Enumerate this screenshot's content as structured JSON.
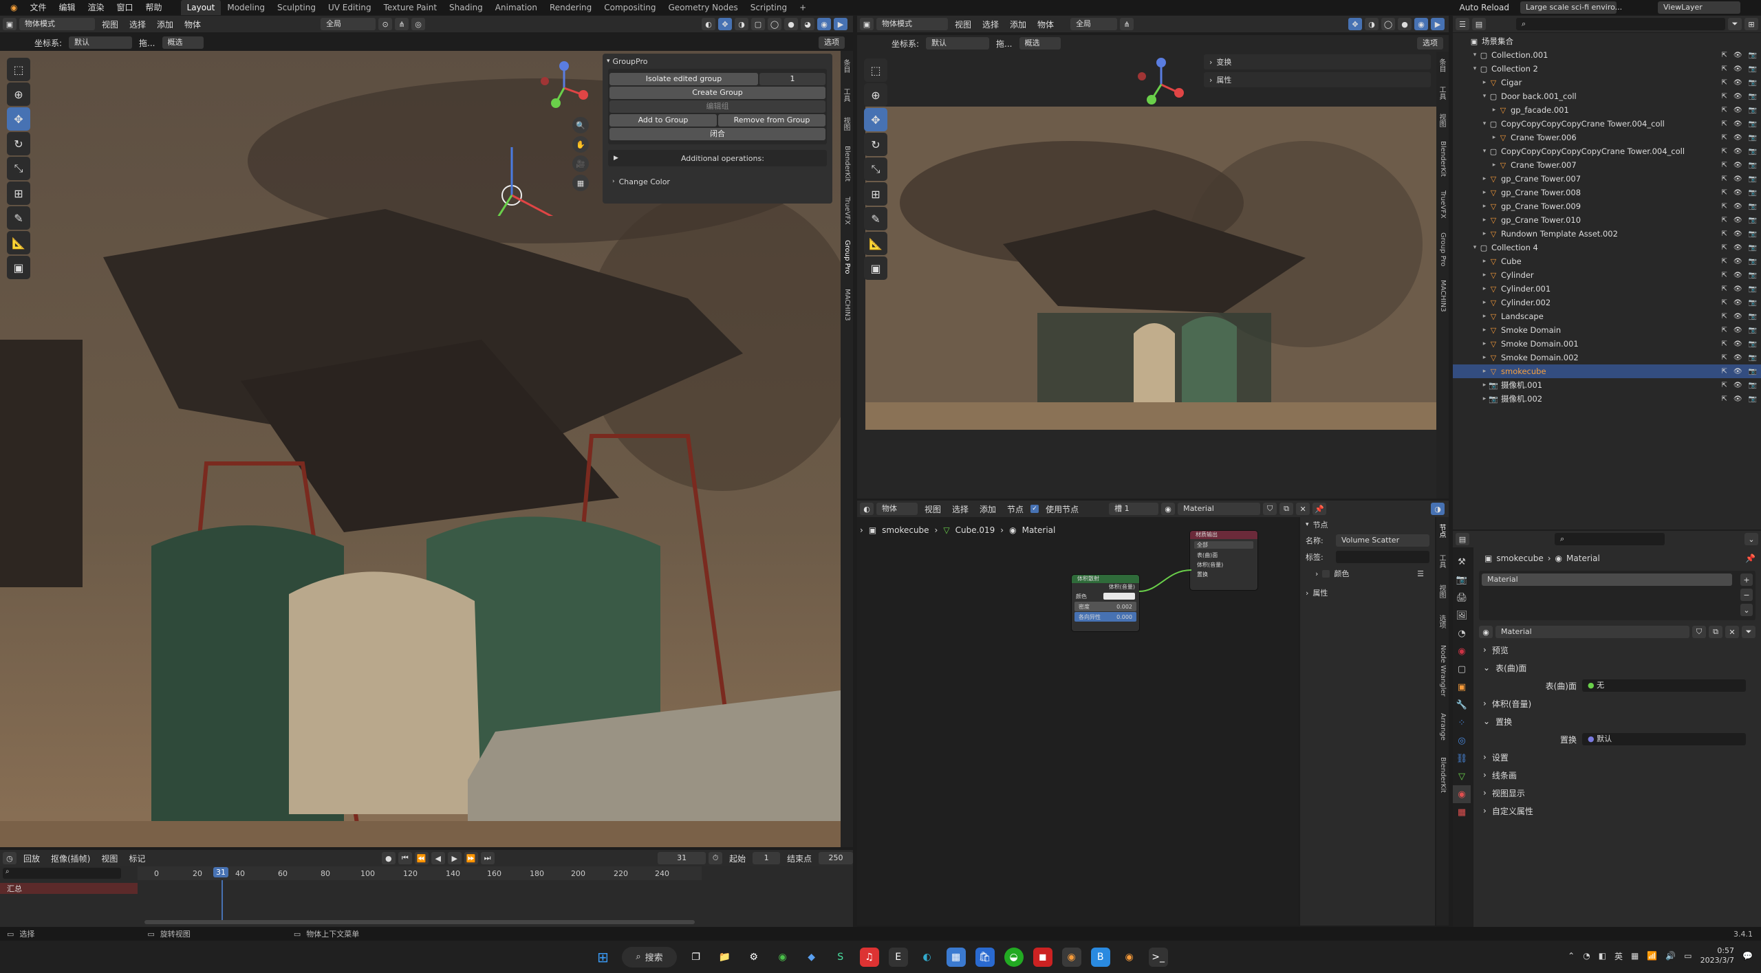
{
  "topbar": {
    "menus": [
      "文件",
      "编辑",
      "渲染",
      "窗口",
      "帮助"
    ],
    "workspaces": [
      "Layout",
      "Modeling",
      "Sculpting",
      "UV Editing",
      "Texture Paint",
      "Shading",
      "Animation",
      "Rendering",
      "Compositing",
      "Geometry Nodes",
      "Scripting"
    ],
    "add_tab": "+",
    "auto_reload": "Auto Reload",
    "scene_name": "Large scale sci-fi enviro...",
    "view_layer": "ViewLayer"
  },
  "viewport_left": {
    "mode": "物体模式",
    "menus": [
      "视图",
      "选择",
      "添加",
      "物体"
    ],
    "transform_space": "全局",
    "coord_label": "坐标系:",
    "coord_value": "默认",
    "drag_label": "拖...",
    "drag_value": "概选",
    "options_label": "选项",
    "side_tabs": [
      "条目",
      "工具",
      "视图",
      "BlenderKit",
      "TrueVFX",
      "Group Pro",
      "MACHIN3"
    ]
  },
  "grouppro": {
    "title": "GroupPro",
    "isolate_label": "Isolate edited group",
    "isolate_value": "1",
    "create_group": "Create Group",
    "edit_group": "编辑组",
    "add_to_group": "Add to Group",
    "remove_from_group": "Remove from Group",
    "close_label": "闭合",
    "additional_ops": "Additional operations:",
    "change_color": "Change Color"
  },
  "viewport_right": {
    "mode": "物体模式",
    "menus": [
      "视图",
      "选择",
      "添加",
      "物体"
    ],
    "transform_space": "全局",
    "coord_label": "坐标系:",
    "coord_value": "默认",
    "drag_label": "拖...",
    "drag_value": "概选",
    "options_label": "选项",
    "n_panel": [
      "变换",
      "属性"
    ],
    "side_tabs": [
      "条目",
      "工具",
      "视图",
      "BlenderKit",
      "TrueVFX",
      "Group Pro",
      "MACHIN3"
    ]
  },
  "outliner": {
    "root": "场景集合",
    "rows": [
      {
        "name": "Collection.001",
        "indent": 1,
        "type": "coll"
      },
      {
        "name": "Collection 2",
        "indent": 1,
        "type": "coll"
      },
      {
        "name": "Cigar",
        "indent": 2,
        "type": "obj"
      },
      {
        "name": "Door back.001_coll",
        "indent": 2,
        "type": "coll"
      },
      {
        "name": "gp_facade.001",
        "indent": 3,
        "type": "obj"
      },
      {
        "name": "CopyCopyCopyCopyCrane Tower.004_coll",
        "indent": 2,
        "type": "coll"
      },
      {
        "name": "Crane Tower.006",
        "indent": 3,
        "type": "obj"
      },
      {
        "name": "CopyCopyCopyCopyCopyCrane Tower.004_coll",
        "indent": 2,
        "type": "coll"
      },
      {
        "name": "Crane Tower.007",
        "indent": 3,
        "type": "obj"
      },
      {
        "name": "gp_Crane Tower.007",
        "indent": 2,
        "type": "obj"
      },
      {
        "name": "gp_Crane Tower.008",
        "indent": 2,
        "type": "obj"
      },
      {
        "name": "gp_Crane Tower.009",
        "indent": 2,
        "type": "obj"
      },
      {
        "name": "gp_Crane Tower.010",
        "indent": 2,
        "type": "obj"
      },
      {
        "name": "Rundown Template Asset.002",
        "indent": 2,
        "type": "obj"
      },
      {
        "name": "Collection 4",
        "indent": 1,
        "type": "coll"
      },
      {
        "name": "Cube",
        "indent": 2,
        "type": "obj"
      },
      {
        "name": "Cylinder",
        "indent": 2,
        "type": "obj"
      },
      {
        "name": "Cylinder.001",
        "indent": 2,
        "type": "obj"
      },
      {
        "name": "Cylinder.002",
        "indent": 2,
        "type": "obj"
      },
      {
        "name": "Landscape",
        "indent": 2,
        "type": "obj"
      },
      {
        "name": "Smoke Domain",
        "indent": 2,
        "type": "obj"
      },
      {
        "name": "Smoke Domain.001",
        "indent": 2,
        "type": "obj"
      },
      {
        "name": "Smoke Domain.002",
        "indent": 2,
        "type": "obj"
      },
      {
        "name": "smokecube",
        "indent": 2,
        "type": "obj",
        "selected": true
      },
      {
        "name": "摄像机.001",
        "indent": 2,
        "type": "cam"
      },
      {
        "name": "摄像机.002",
        "indent": 2,
        "type": "cam"
      }
    ]
  },
  "node_editor": {
    "type": "物体",
    "menus": [
      "视图",
      "选择",
      "添加",
      "节点"
    ],
    "use_nodes": "使用节点",
    "slot": "槽 1",
    "material": "Material",
    "breadcrumb": [
      "smokecube",
      "Cube.019",
      "Material"
    ],
    "node_volume": {
      "title": "体积散射",
      "output": "体积(音量)",
      "rows": [
        {
          "label": "颜色",
          "value": ""
        },
        {
          "label": "密度",
          "value": "0.002"
        },
        {
          "label": "各向异性",
          "value": "0.000"
        }
      ]
    },
    "node_output": {
      "title": "材质输出",
      "target": "全部",
      "inputs": [
        "表(曲)面",
        "体积(音量)",
        "置换"
      ]
    },
    "sidebar": {
      "section": "节点",
      "name_label": "名称:",
      "name_value": "Volume Scatter",
      "label_label": "标签:",
      "color": "颜色",
      "props": "属性"
    },
    "side_tabs": [
      "节点",
      "工具",
      "视图",
      "选项",
      "Node Wrangler",
      "Arrange",
      "BlenderKit"
    ]
  },
  "properties": {
    "breadcrumb": [
      "smokecube",
      "Material"
    ],
    "slot_name": "Material",
    "material_name": "Material",
    "sections": [
      "预览",
      "表(曲)面",
      "体积(音量)",
      "置换",
      "设置",
      "线条画",
      "视图显示",
      "自定义属性"
    ],
    "surface_label": "表(曲)面",
    "surface_value": "无",
    "displace_label": "置换",
    "displace_value": "默认"
  },
  "timeline": {
    "menus": [
      "回放",
      "抠像(插帧)",
      "视图",
      "标记"
    ],
    "current_frame": "31",
    "start_label": "起始",
    "start_value": "1",
    "end_label": "结束点",
    "end_value": "250",
    "ticks": [
      "0",
      "20",
      "31",
      "40",
      "60",
      "80",
      "100",
      "120",
      "140",
      "160",
      "180",
      "200",
      "220",
      "240"
    ],
    "summary": "汇总"
  },
  "statusbar": {
    "select": "选择",
    "rotate": "旋转视图",
    "context": "物体上下文菜单",
    "version": "3.4.1"
  },
  "taskbar": {
    "search": "搜索",
    "time": "0:57",
    "date": "2023/3/7",
    "ime": "英"
  },
  "colors": {
    "accent": "#4772b3",
    "selected_row": "#334d80",
    "node_green": "#2f6b3a",
    "node_red": "#6b2a3a"
  }
}
